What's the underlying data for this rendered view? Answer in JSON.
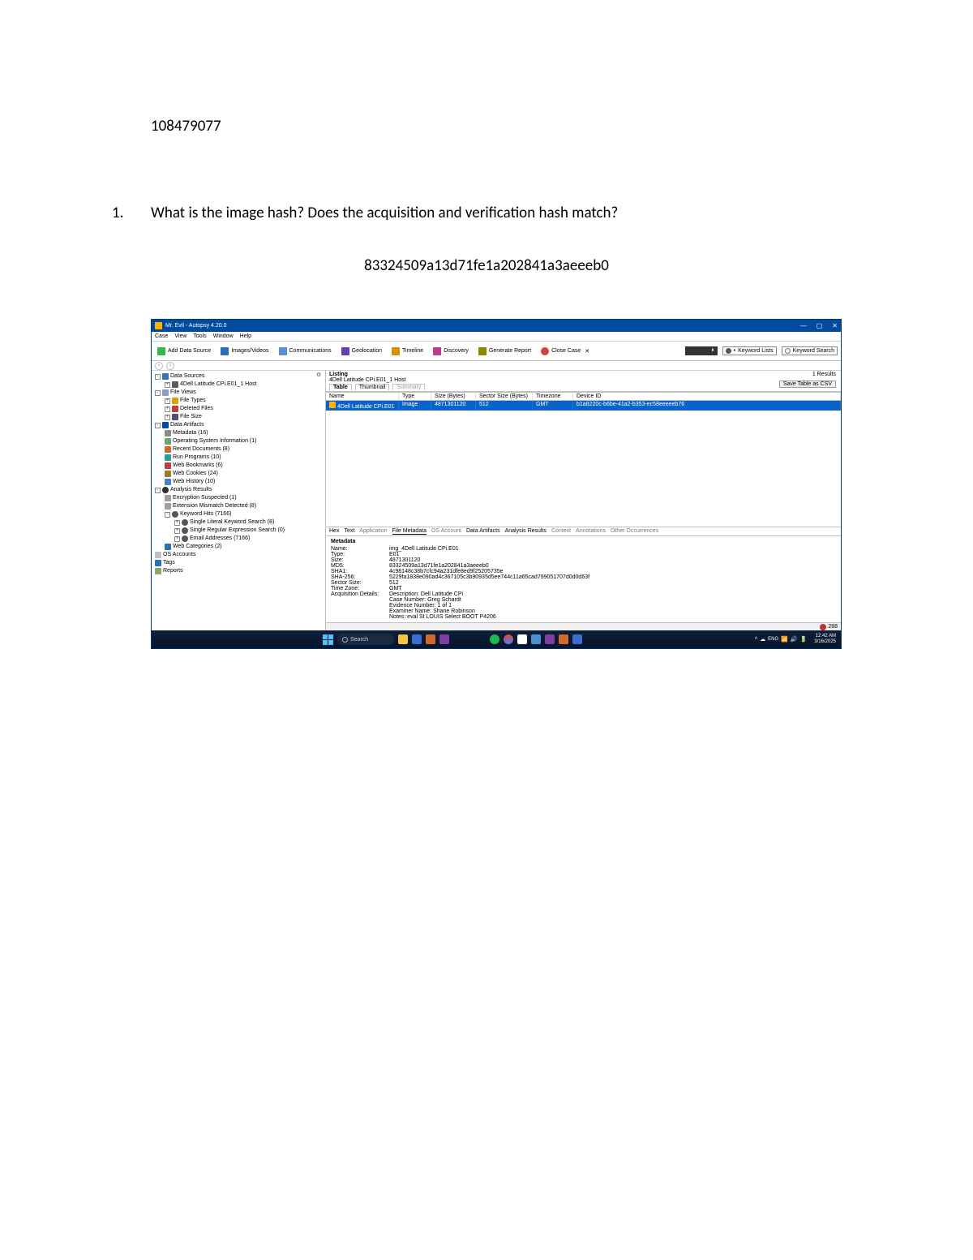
{
  "doc": {
    "id": "108479077"
  },
  "question": {
    "num": "1.",
    "text": "What is the image hash? Does the acquisition and verification hash match?"
  },
  "answer": {
    "hash": "83324509a13d71fe1a202841a3aeeeb0"
  },
  "app": {
    "title": "Mr. Evil - Autopsy 4.20.0",
    "menu": [
      "Case",
      "View",
      "Tools",
      "Window",
      "Help"
    ],
    "toolbar": {
      "add_ds": "Add Data Source",
      "img_vid": "Images/Videos",
      "comm": "Communications",
      "geo": "Geolocation",
      "timeline": "Timeline",
      "discovery": "Discovery",
      "report": "Generate Report",
      "close": "Close Case",
      "kw_list": "Keyword Lists",
      "kw_search": "Keyword Search"
    },
    "tree": {
      "data_sources": "Data Sources",
      "host": "4Dell Latitude CPi.E01_1 Host",
      "file_views": "File Views",
      "file_types": "File Types",
      "deleted": "Deleted Files",
      "file_size": "File Size",
      "data_artifacts": "Data Artifacts",
      "metadata": "Metadata (16)",
      "os_info": "Operating System Information (1)",
      "recent_docs": "Recent Documents (8)",
      "run_prog": "Run Programs (10)",
      "bookmarks": "Web Bookmarks (6)",
      "cookies": "Web Cookies (24)",
      "history": "Web History (10)",
      "analysis": "Analysis Results",
      "enc": "Encryption Suspected (1)",
      "ext": "Extension Mismatch Detected (8)",
      "kw_hits": "Keyword Hits (7166)",
      "kw_lit": "Single Literal Keyword Search (8)",
      "kw_reg": "Single Regular Expression Search (0)",
      "emails": "Email Addresses (7166)",
      "web_cat": "Web Categories (2)",
      "os_acct": "OS Accounts",
      "tags": "Tags",
      "reports": "Reports"
    },
    "listing": {
      "header": "Listing",
      "path": "4Dell Latitude CPi.E01_1 Host",
      "tabs": {
        "table": "Table",
        "thumb": "Thumbnail",
        "summary": "Summary"
      },
      "results": "1 Results",
      "save_csv": "Save Table as CSV",
      "cols": {
        "name": "Name",
        "type": "Type",
        "size": "Size (Bytes)",
        "sector": "Sector Size (Bytes)",
        "tz": "Timezone",
        "dev": "Device ID"
      },
      "row": {
        "name": "4Dell Latitude CPi.E01",
        "type": "Image",
        "size": "4871301120",
        "sector": "512",
        "tz": "GMT",
        "dev": "b1a8220c-b6be-41a2-b353-ec58eeeeeb76"
      }
    },
    "details": {
      "tabs": {
        "hex": "Hex",
        "text": "Text",
        "app": "Application",
        "file_md": "File Metadata",
        "os_acct": "OS Account",
        "da": "Data Artifacts",
        "ar": "Analysis Results",
        "ctx": "Context",
        "ann": "Annotations",
        "other": "Other Occurrences"
      },
      "title": "Metadata",
      "rows": {
        "name_k": "Name:",
        "name_v": "img_4Dell Latitude CPi.E01",
        "type_k": "Type:",
        "type_v": "E01",
        "size_k": "Size:",
        "size_v": "4871301120",
        "md5_k": "MD5:",
        "md5_v": "83324509a13d71fe1a202841a3aeeeb0",
        "sha1_k": "SHA1:",
        "sha1_v": "4c98148c38b7cfc94a231dfe8ed9f25205735e",
        "sha256_k": "SHA-256:",
        "sha256_v": "5229fa1838e090ad4c367105c3b90935d5ee744c11a65cad799051707d0d0d63f",
        "sect_k": "Sector Size:",
        "sect_v": "512",
        "tz_k": "Time Zone:",
        "tz_v": "GMT",
        "acq_k": "Acquisition Details:",
        "acq_v": "Description: Dell Latitude CPi",
        "case_k": "",
        "case_v": "Case Number: Greg Schardt",
        "evd_k": "",
        "evd_v": "Evidence Number: 1 of 1",
        "exam_k": "",
        "exam_v": "Examiner Name: Shane Robinson",
        "notes_k": "",
        "notes_v": "Notes: eval St LOUIS Select BOOT P4206"
      }
    },
    "status": {
      "err": "288"
    },
    "taskbar": {
      "search": "Search",
      "time": "12:42 AM",
      "date": "3/16/2025"
    }
  }
}
